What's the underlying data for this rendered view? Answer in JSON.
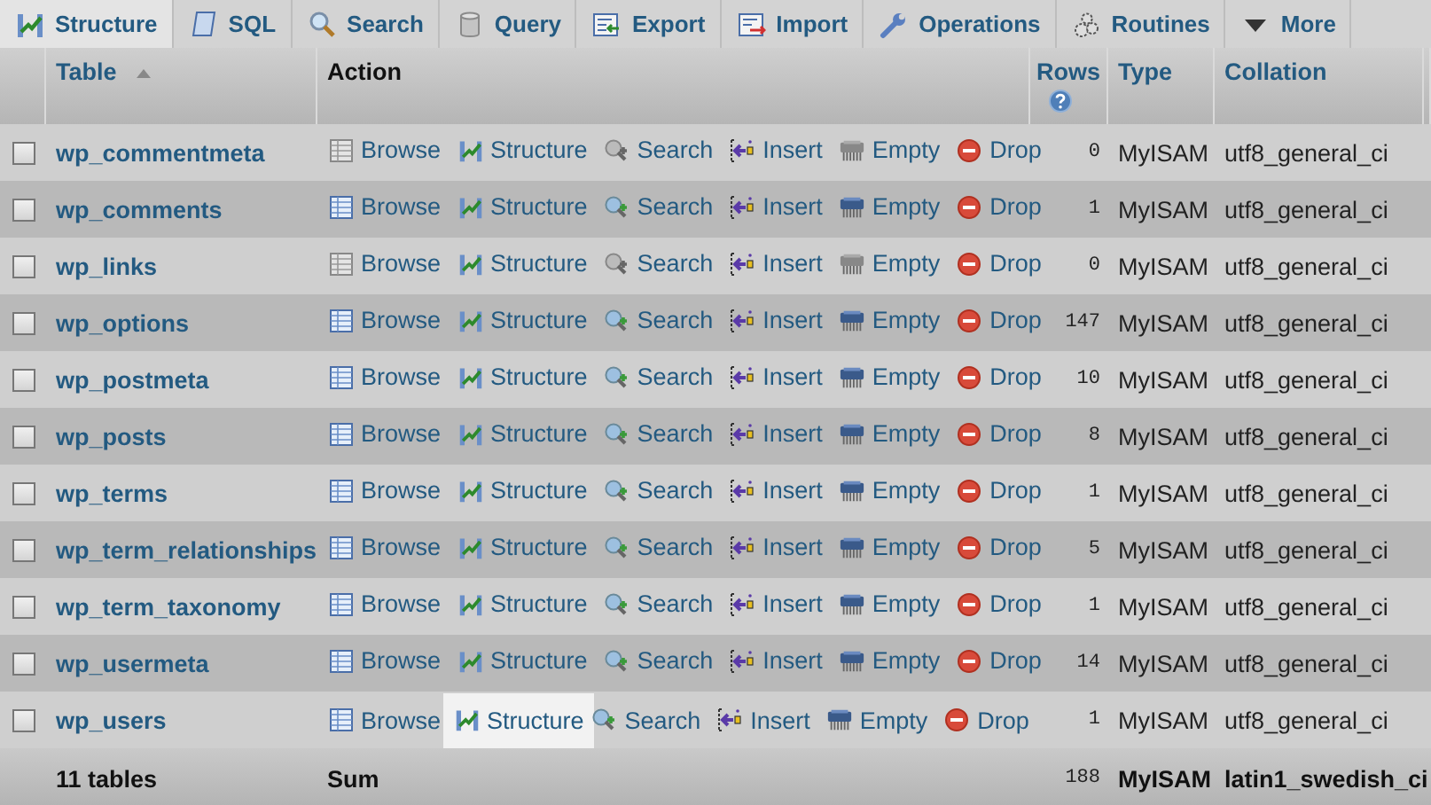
{
  "tabs": [
    {
      "label": "Structure",
      "kind": "structure",
      "selected": true
    },
    {
      "label": "SQL",
      "kind": "sql",
      "selected": false
    },
    {
      "label": "Search",
      "kind": "search",
      "selected": false
    },
    {
      "label": "Query",
      "kind": "query",
      "selected": false
    },
    {
      "label": "Export",
      "kind": "export",
      "selected": false
    },
    {
      "label": "Import",
      "kind": "import",
      "selected": false
    },
    {
      "label": "Operations",
      "kind": "operations",
      "selected": false
    },
    {
      "label": "Routines",
      "kind": "routines",
      "selected": false
    },
    {
      "label": "More",
      "kind": "more",
      "selected": false
    }
  ],
  "header": {
    "table": "Table",
    "action": "Action",
    "rows": "Rows",
    "type": "Type",
    "collation": "Collation"
  },
  "rows": [
    {
      "name": "wp_commentmeta",
      "checked": false,
      "rows": "0",
      "type": "MyISAM",
      "collation": "utf8_general_ci",
      "actions": [
        {
          "kind": "browse",
          "label": "Browse",
          "disabled": true,
          "highlighted": false
        },
        {
          "kind": "structure",
          "label": "Structure",
          "disabled": false,
          "highlighted": false
        },
        {
          "kind": "search",
          "label": "Search",
          "disabled": true,
          "highlighted": false
        },
        {
          "kind": "insert",
          "label": "Insert",
          "disabled": false,
          "highlighted": false
        },
        {
          "kind": "empty",
          "label": "Empty",
          "disabled": true,
          "highlighted": false
        },
        {
          "kind": "drop",
          "label": "Drop",
          "disabled": false,
          "highlighted": false
        }
      ]
    },
    {
      "name": "wp_comments",
      "checked": false,
      "rows": "1",
      "type": "MyISAM",
      "collation": "utf8_general_ci",
      "actions": [
        {
          "kind": "browse",
          "label": "Browse",
          "disabled": false,
          "highlighted": false
        },
        {
          "kind": "structure",
          "label": "Structure",
          "disabled": false,
          "highlighted": false
        },
        {
          "kind": "search",
          "label": "Search",
          "disabled": false,
          "highlighted": false
        },
        {
          "kind": "insert",
          "label": "Insert",
          "disabled": false,
          "highlighted": false
        },
        {
          "kind": "empty",
          "label": "Empty",
          "disabled": false,
          "highlighted": false
        },
        {
          "kind": "drop",
          "label": "Drop",
          "disabled": false,
          "highlighted": false
        }
      ]
    },
    {
      "name": "wp_links",
      "checked": false,
      "rows": "0",
      "type": "MyISAM",
      "collation": "utf8_general_ci",
      "actions": [
        {
          "kind": "browse",
          "label": "Browse",
          "disabled": true,
          "highlighted": false
        },
        {
          "kind": "structure",
          "label": "Structure",
          "disabled": false,
          "highlighted": false
        },
        {
          "kind": "search",
          "label": "Search",
          "disabled": true,
          "highlighted": false
        },
        {
          "kind": "insert",
          "label": "Insert",
          "disabled": false,
          "highlighted": false
        },
        {
          "kind": "empty",
          "label": "Empty",
          "disabled": true,
          "highlighted": false
        },
        {
          "kind": "drop",
          "label": "Drop",
          "disabled": false,
          "highlighted": false
        }
      ]
    },
    {
      "name": "wp_options",
      "checked": false,
      "rows": "147",
      "type": "MyISAM",
      "collation": "utf8_general_ci",
      "actions": [
        {
          "kind": "browse",
          "label": "Browse",
          "disabled": false,
          "highlighted": false
        },
        {
          "kind": "structure",
          "label": "Structure",
          "disabled": false,
          "highlighted": false
        },
        {
          "kind": "search",
          "label": "Search",
          "disabled": false,
          "highlighted": false
        },
        {
          "kind": "insert",
          "label": "Insert",
          "disabled": false,
          "highlighted": false
        },
        {
          "kind": "empty",
          "label": "Empty",
          "disabled": false,
          "highlighted": false
        },
        {
          "kind": "drop",
          "label": "Drop",
          "disabled": false,
          "highlighted": false
        }
      ]
    },
    {
      "name": "wp_postmeta",
      "checked": false,
      "rows": "10",
      "type": "MyISAM",
      "collation": "utf8_general_ci",
      "actions": [
        {
          "kind": "browse",
          "label": "Browse",
          "disabled": false,
          "highlighted": false
        },
        {
          "kind": "structure",
          "label": "Structure",
          "disabled": false,
          "highlighted": false
        },
        {
          "kind": "search",
          "label": "Search",
          "disabled": false,
          "highlighted": false
        },
        {
          "kind": "insert",
          "label": "Insert",
          "disabled": false,
          "highlighted": false
        },
        {
          "kind": "empty",
          "label": "Empty",
          "disabled": false,
          "highlighted": false
        },
        {
          "kind": "drop",
          "label": "Drop",
          "disabled": false,
          "highlighted": false
        }
      ]
    },
    {
      "name": "wp_posts",
      "checked": false,
      "rows": "8",
      "type": "MyISAM",
      "collation": "utf8_general_ci",
      "actions": [
        {
          "kind": "browse",
          "label": "Browse",
          "disabled": false,
          "highlighted": false
        },
        {
          "kind": "structure",
          "label": "Structure",
          "disabled": false,
          "highlighted": false
        },
        {
          "kind": "search",
          "label": "Search",
          "disabled": false,
          "highlighted": false
        },
        {
          "kind": "insert",
          "label": "Insert",
          "disabled": false,
          "highlighted": false
        },
        {
          "kind": "empty",
          "label": "Empty",
          "disabled": false,
          "highlighted": false
        },
        {
          "kind": "drop",
          "label": "Drop",
          "disabled": false,
          "highlighted": false
        }
      ]
    },
    {
      "name": "wp_terms",
      "checked": false,
      "rows": "1",
      "type": "MyISAM",
      "collation": "utf8_general_ci",
      "actions": [
        {
          "kind": "browse",
          "label": "Browse",
          "disabled": false,
          "highlighted": false
        },
        {
          "kind": "structure",
          "label": "Structure",
          "disabled": false,
          "highlighted": false
        },
        {
          "kind": "search",
          "label": "Search",
          "disabled": false,
          "highlighted": false
        },
        {
          "kind": "insert",
          "label": "Insert",
          "disabled": false,
          "highlighted": false
        },
        {
          "kind": "empty",
          "label": "Empty",
          "disabled": false,
          "highlighted": false
        },
        {
          "kind": "drop",
          "label": "Drop",
          "disabled": false,
          "highlighted": false
        }
      ]
    },
    {
      "name": "wp_term_relationships",
      "checked": false,
      "rows": "5",
      "type": "MyISAM",
      "collation": "utf8_general_ci",
      "actions": [
        {
          "kind": "browse",
          "label": "Browse",
          "disabled": false,
          "highlighted": false
        },
        {
          "kind": "structure",
          "label": "Structure",
          "disabled": false,
          "highlighted": false
        },
        {
          "kind": "search",
          "label": "Search",
          "disabled": false,
          "highlighted": false
        },
        {
          "kind": "insert",
          "label": "Insert",
          "disabled": false,
          "highlighted": false
        },
        {
          "kind": "empty",
          "label": "Empty",
          "disabled": false,
          "highlighted": false
        },
        {
          "kind": "drop",
          "label": "Drop",
          "disabled": false,
          "highlighted": false
        }
      ]
    },
    {
      "name": "wp_term_taxonomy",
      "checked": false,
      "rows": "1",
      "type": "MyISAM",
      "collation": "utf8_general_ci",
      "actions": [
        {
          "kind": "browse",
          "label": "Browse",
          "disabled": false,
          "highlighted": false
        },
        {
          "kind": "structure",
          "label": "Structure",
          "disabled": false,
          "highlighted": false
        },
        {
          "kind": "search",
          "label": "Search",
          "disabled": false,
          "highlighted": false
        },
        {
          "kind": "insert",
          "label": "Insert",
          "disabled": false,
          "highlighted": false
        },
        {
          "kind": "empty",
          "label": "Empty",
          "disabled": false,
          "highlighted": false
        },
        {
          "kind": "drop",
          "label": "Drop",
          "disabled": false,
          "highlighted": false
        }
      ]
    },
    {
      "name": "wp_usermeta",
      "checked": false,
      "rows": "14",
      "type": "MyISAM",
      "collation": "utf8_general_ci",
      "actions": [
        {
          "kind": "browse",
          "label": "Browse",
          "disabled": false,
          "highlighted": false
        },
        {
          "kind": "structure",
          "label": "Structure",
          "disabled": false,
          "highlighted": false
        },
        {
          "kind": "search",
          "label": "Search",
          "disabled": false,
          "highlighted": false
        },
        {
          "kind": "insert",
          "label": "Insert",
          "disabled": false,
          "highlighted": false
        },
        {
          "kind": "empty",
          "label": "Empty",
          "disabled": false,
          "highlighted": false
        },
        {
          "kind": "drop",
          "label": "Drop",
          "disabled": false,
          "highlighted": false
        }
      ]
    },
    {
      "name": "wp_users",
      "checked": false,
      "rows": "1",
      "type": "MyISAM",
      "collation": "utf8_general_ci",
      "actions": [
        {
          "kind": "browse",
          "label": "Browse",
          "disabled": false,
          "highlighted": false
        },
        {
          "kind": "structure",
          "label": "Structure",
          "disabled": false,
          "highlighted": true
        },
        {
          "kind": "search",
          "label": "Search",
          "disabled": false,
          "highlighted": false
        },
        {
          "kind": "insert",
          "label": "Insert",
          "disabled": false,
          "highlighted": false
        },
        {
          "kind": "empty",
          "label": "Empty",
          "disabled": false,
          "highlighted": false
        },
        {
          "kind": "drop",
          "label": "Drop",
          "disabled": false,
          "highlighted": false
        }
      ]
    }
  ],
  "footer": {
    "tables": "11 tables",
    "action": "Sum",
    "rows": "188",
    "type": "MyISAM",
    "collation": "latin1_swedish_ci"
  }
}
